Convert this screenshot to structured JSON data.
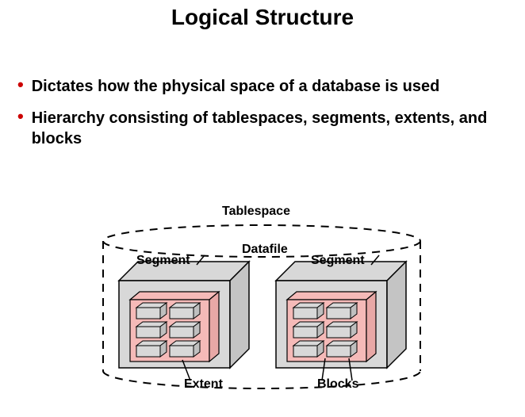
{
  "title": "Logical Structure",
  "bullets": [
    "Dictates how the physical space of a database is used",
    "Hierarchy consisting of tablespaces, segments, extents, and blocks"
  ],
  "diagram": {
    "labels": {
      "tablespace": "Tablespace",
      "datafile": "Datafile",
      "segment_left": "Segment",
      "segment_right": "Segment",
      "extent": "Extent",
      "blocks": "Blocks"
    }
  }
}
